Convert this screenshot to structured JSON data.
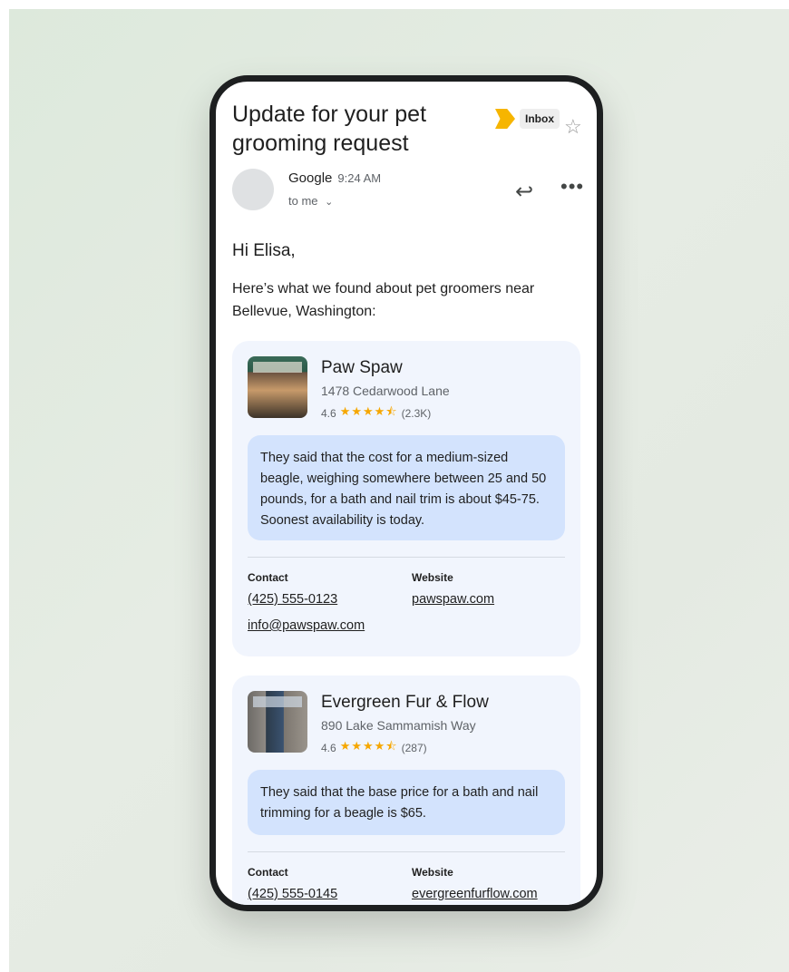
{
  "email": {
    "subject": "Update for your pet grooming request",
    "label": "Inbox",
    "sender": "Google",
    "time": "9:24 AM",
    "recipient": "to me",
    "greeting": "Hi Elisa,",
    "intro": "Here’s what we found about pet groomers near Bellevue, Washington:"
  },
  "icons": {
    "label": "label-chevron-icon",
    "star": "star-icon",
    "reply": "reply-icon",
    "more": "more-icon",
    "chevron": "chevron-down-icon"
  },
  "colors": {
    "label_accent": "#f6b500",
    "card_bg": "#f1f5fd",
    "bubble_bg": "#d3e3fd",
    "rating_star": "#f6a700"
  },
  "results": [
    {
      "name": "Paw Spaw",
      "address": "1478 Cedarwood Lane",
      "rating": "4.6",
      "stars": 4.5,
      "reviews": "(2.3K)",
      "summary": "They said that the cost for a medium-sized beagle, weighing somewhere between 25 and 50 pounds, for a bath and nail trim is about $45-75. Soonest availability is today.",
      "contact_label": "Contact",
      "website_label": "Website",
      "phone": "(425) 555-0123",
      "email": "info@pawspaw.com",
      "website": "pawspaw.com"
    },
    {
      "name": "Evergreen Fur & Flow",
      "address": "890 Lake Sammamish Way",
      "rating": "4.6",
      "stars": 4.5,
      "reviews": "(287)",
      "summary": "They said that the base price for a bath and nail trimming for a beagle is $65.",
      "contact_label": "Contact",
      "website_label": "Website",
      "phone": "(425) 555-0145",
      "website": "evergreenfurflow.com"
    }
  ]
}
